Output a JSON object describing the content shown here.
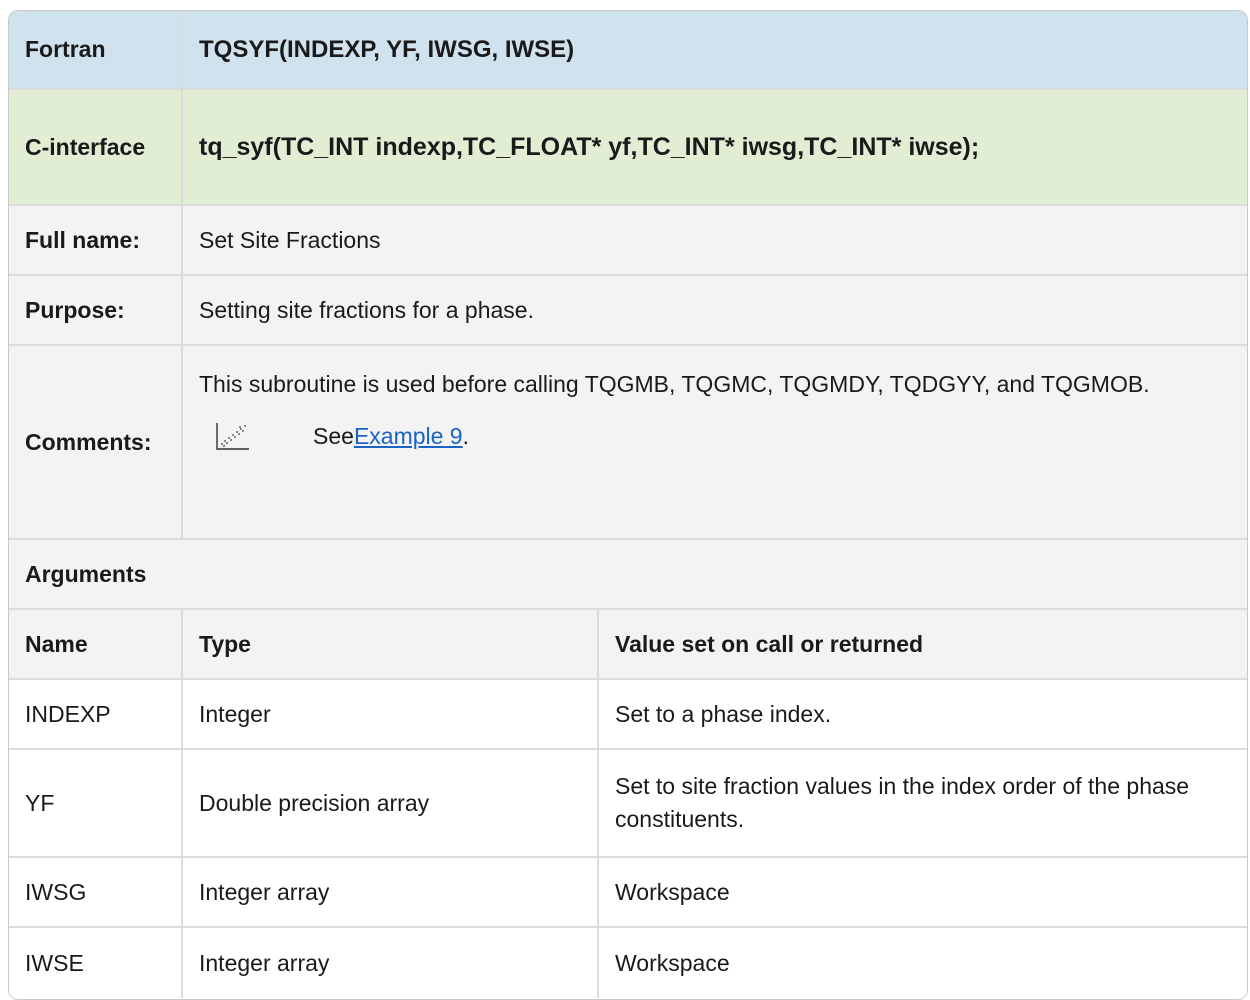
{
  "fortran": {
    "label": "Fortran",
    "signature": "TQSYF(INDEXP, YF, IWSG, IWSE)"
  },
  "c_interface": {
    "label": "C-interface",
    "signature": "tq_syf(TC_INT indexp,TC_FLOAT* yf,TC_INT* iwsg,TC_INT* iwse);"
  },
  "full_name": {
    "label": "Full name:",
    "value": "Set Site Fractions"
  },
  "purpose": {
    "label": "Purpose:",
    "value": "Setting site fractions for a phase."
  },
  "comments": {
    "label": "Comments:",
    "text": "This subroutine is used before calling TQGMB, TQGMC, TQGMDY, TQDGYY, and TQGMOB.",
    "see_prefix": "See ",
    "see_link": "Example 9",
    "see_suffix": ".",
    "icon": "scatter-plot-icon"
  },
  "arguments": {
    "heading": "Arguments",
    "columns": [
      "Name",
      "Type",
      "Value set on call or returned"
    ],
    "rows": [
      [
        "INDEXP",
        "Integer",
        "Set to a phase index."
      ],
      [
        "YF",
        "Double precision array",
        "Set to site fraction values in the index order of the phase constituents."
      ],
      [
        "IWSG",
        "Integer array",
        "Workspace"
      ],
      [
        "IWSE",
        "Integer array",
        "Workspace"
      ]
    ]
  },
  "colors": {
    "header_blue": "#cfe2ee",
    "header_green": "#e2eed4",
    "row_gray": "#f3f3f3",
    "link": "#1a63c4"
  }
}
